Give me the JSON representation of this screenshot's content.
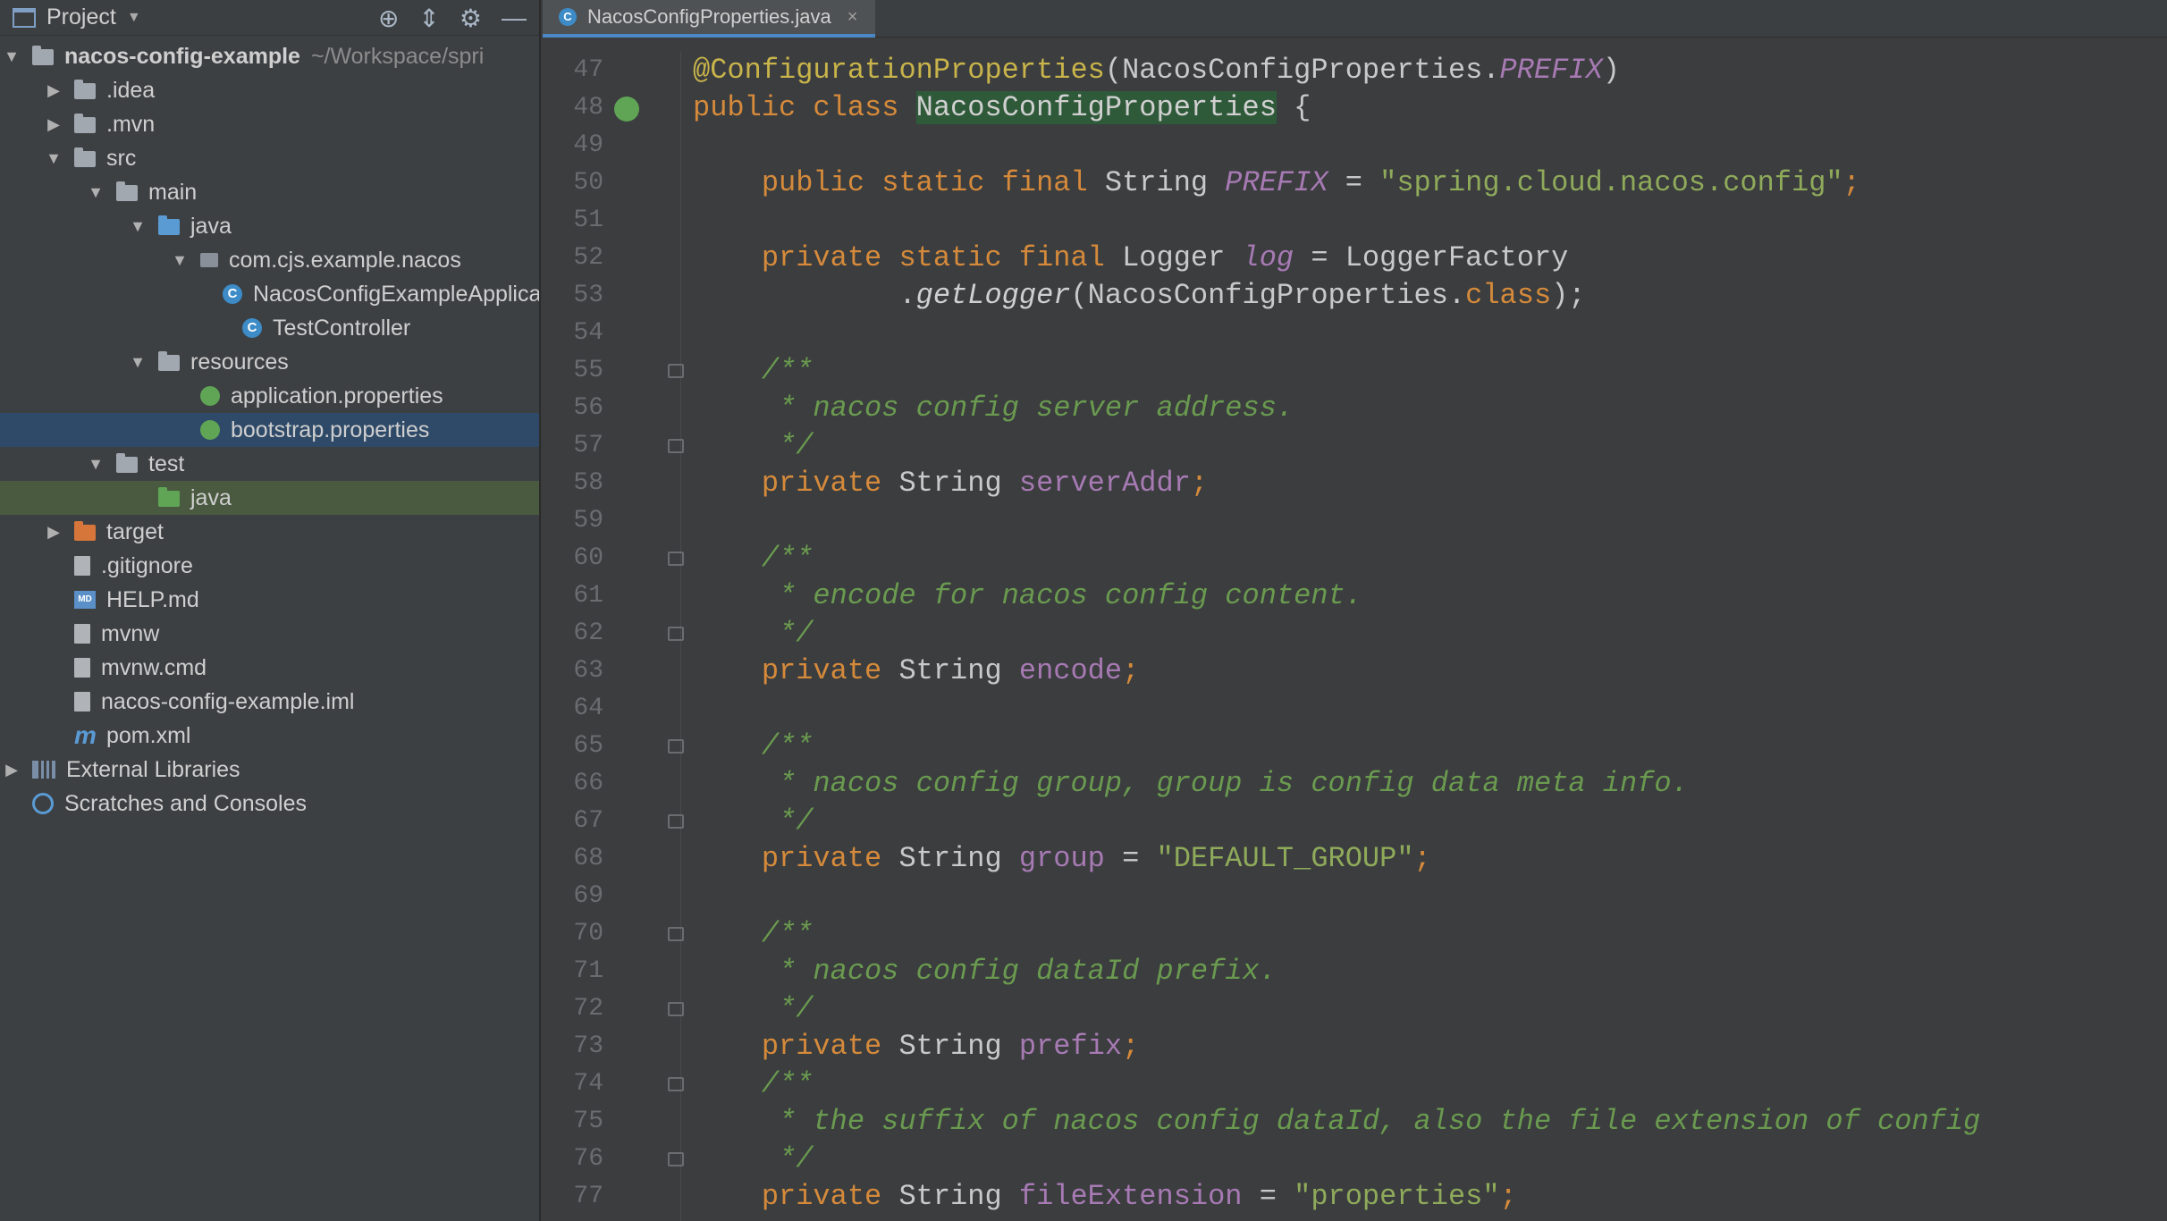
{
  "project": {
    "title": "Project",
    "tree": [
      {
        "label": "nacos-config-example",
        "suffix": "~/Workspace/spri",
        "depth": 0,
        "arrow": "▼",
        "icon": "module-folder",
        "bold": true
      },
      {
        "label": ".idea",
        "depth": 1,
        "arrow": "▶",
        "icon": "folder"
      },
      {
        "label": ".mvn",
        "depth": 1,
        "arrow": "▶",
        "icon": "folder"
      },
      {
        "label": "src",
        "depth": 1,
        "arrow": "▼",
        "icon": "folder"
      },
      {
        "label": "main",
        "depth": 2,
        "arrow": "▼",
        "icon": "folder"
      },
      {
        "label": "java",
        "depth": 3,
        "arrow": "▼",
        "icon": "folder-blue"
      },
      {
        "label": "com.cjs.example.nacos",
        "depth": 4,
        "arrow": "▼",
        "icon": "package"
      },
      {
        "label": "NacosConfigExampleApplica",
        "depth": 5,
        "arrow": "",
        "icon": "class"
      },
      {
        "label": "TestController",
        "depth": 5,
        "arrow": "",
        "icon": "class"
      },
      {
        "label": "resources",
        "depth": 3,
        "arrow": "▼",
        "icon": "folder-res"
      },
      {
        "label": "application.properties",
        "depth": 4,
        "arrow": "",
        "icon": "spring"
      },
      {
        "label": "bootstrap.properties",
        "depth": 4,
        "arrow": "",
        "icon": "spring",
        "selected": true
      },
      {
        "label": "test",
        "depth": 2,
        "arrow": "▼",
        "icon": "folder"
      },
      {
        "label": "java",
        "depth": 3,
        "arrow": "",
        "icon": "folder-green",
        "highlight": true
      },
      {
        "label": "target",
        "depth": 1,
        "arrow": "▶",
        "icon": "folder-orange"
      },
      {
        "label": ".gitignore",
        "depth": 1,
        "arrow": "",
        "icon": "file"
      },
      {
        "label": "HELP.md",
        "depth": 1,
        "arrow": "",
        "icon": "md"
      },
      {
        "label": "mvnw",
        "depth": 1,
        "arrow": "",
        "icon": "file"
      },
      {
        "label": "mvnw.cmd",
        "depth": 1,
        "arrow": "",
        "icon": "file"
      },
      {
        "label": "nacos-config-example.iml",
        "depth": 1,
        "arrow": "",
        "icon": "file"
      },
      {
        "label": "pom.xml",
        "depth": 1,
        "arrow": "",
        "icon": "maven"
      },
      {
        "label": "External Libraries",
        "depth": 0,
        "arrow": "▶",
        "icon": "libs"
      },
      {
        "label": "Scratches and Consoles",
        "depth": 0,
        "arrow": "",
        "icon": "scratch"
      }
    ]
  },
  "editor": {
    "tab": {
      "label": "NacosConfigProperties.java",
      "icon_letter": "C"
    },
    "lines": [
      {
        "n": "47",
        "tokens": [
          [
            "ann",
            "@ConfigurationProperties"
          ],
          [
            "",
            "(NacosConfigProperties."
          ],
          [
            "fldi",
            "PREFIX"
          ],
          [
            "",
            ")"
          ]
        ]
      },
      {
        "n": "48",
        "run": true,
        "tokens": [
          [
            "kw",
            "public class "
          ],
          [
            "hl",
            "NacosConfigProperties"
          ],
          [
            "",
            " {"
          ]
        ]
      },
      {
        "n": "49",
        "tokens": []
      },
      {
        "n": "50",
        "tokens": [
          [
            "",
            "    "
          ],
          [
            "kw",
            "public static final "
          ],
          [
            "",
            "String "
          ],
          [
            "fldi",
            "PREFIX"
          ],
          [
            "",
            " = "
          ],
          [
            "str",
            "\"spring.cloud.nacos.config\""
          ],
          [
            "kw",
            ";"
          ]
        ]
      },
      {
        "n": "51",
        "tokens": []
      },
      {
        "n": "52",
        "tokens": [
          [
            "",
            "    "
          ],
          [
            "kw",
            "private static final "
          ],
          [
            "",
            "Logger "
          ],
          [
            "fldi",
            "log"
          ],
          [
            "",
            " = LoggerFactory"
          ]
        ]
      },
      {
        "n": "53",
        "tokens": [
          [
            "",
            "            ."
          ],
          [
            "mth",
            "getLogger"
          ],
          [
            "",
            "(NacosConfigProperties."
          ],
          [
            "kw",
            "class"
          ],
          [
            "",
            ");"
          ]
        ]
      },
      {
        "n": "54",
        "tokens": []
      },
      {
        "n": "55",
        "fold": true,
        "tokens": [
          [
            "",
            "    "
          ],
          [
            "cm",
            "/**"
          ]
        ]
      },
      {
        "n": "56",
        "tokens": [
          [
            "",
            "    "
          ],
          [
            "cm",
            " * nacos config server address."
          ]
        ]
      },
      {
        "n": "57",
        "fold": true,
        "tokens": [
          [
            "",
            "    "
          ],
          [
            "cm",
            " */"
          ]
        ]
      },
      {
        "n": "58",
        "tokens": [
          [
            "",
            "    "
          ],
          [
            "kw",
            "private "
          ],
          [
            "",
            "String "
          ],
          [
            "fld",
            "serverAddr"
          ],
          [
            "kw",
            ";"
          ]
        ]
      },
      {
        "n": "59",
        "tokens": []
      },
      {
        "n": "60",
        "fold": true,
        "tokens": [
          [
            "",
            "    "
          ],
          [
            "cm",
            "/**"
          ]
        ]
      },
      {
        "n": "61",
        "tokens": [
          [
            "",
            "    "
          ],
          [
            "cm",
            " * encode for nacos config content."
          ]
        ]
      },
      {
        "n": "62",
        "fold": true,
        "tokens": [
          [
            "",
            "    "
          ],
          [
            "cm",
            " */"
          ]
        ]
      },
      {
        "n": "63",
        "tokens": [
          [
            "",
            "    "
          ],
          [
            "kw",
            "private "
          ],
          [
            "",
            "String "
          ],
          [
            "fld",
            "encode"
          ],
          [
            "kw",
            ";"
          ]
        ]
      },
      {
        "n": "64",
        "tokens": []
      },
      {
        "n": "65",
        "fold": true,
        "tokens": [
          [
            "",
            "    "
          ],
          [
            "cm",
            "/**"
          ]
        ]
      },
      {
        "n": "66",
        "tokens": [
          [
            "",
            "    "
          ],
          [
            "cm",
            " * nacos config group, group is config data meta info."
          ]
        ]
      },
      {
        "n": "67",
        "fold": true,
        "tokens": [
          [
            "",
            "    "
          ],
          [
            "cm",
            " */"
          ]
        ]
      },
      {
        "n": "68",
        "tokens": [
          [
            "",
            "    "
          ],
          [
            "kw",
            "private "
          ],
          [
            "",
            "String "
          ],
          [
            "fld",
            "group"
          ],
          [
            "",
            " = "
          ],
          [
            "str",
            "\"DEFAULT_GROUP\""
          ],
          [
            "kw",
            ";"
          ]
        ]
      },
      {
        "n": "69",
        "tokens": []
      },
      {
        "n": "70",
        "fold": true,
        "tokens": [
          [
            "",
            "    "
          ],
          [
            "cm",
            "/**"
          ]
        ]
      },
      {
        "n": "71",
        "tokens": [
          [
            "",
            "    "
          ],
          [
            "cm",
            " * nacos config dataId prefix."
          ]
        ]
      },
      {
        "n": "72",
        "fold": true,
        "tokens": [
          [
            "",
            "    "
          ],
          [
            "cm",
            " */"
          ]
        ]
      },
      {
        "n": "73",
        "tokens": [
          [
            "",
            "    "
          ],
          [
            "kw",
            "private "
          ],
          [
            "",
            "String "
          ],
          [
            "fld",
            "prefix"
          ],
          [
            "kw",
            ";"
          ]
        ]
      },
      {
        "n": "74",
        "fold": true,
        "tokens": [
          [
            "",
            "    "
          ],
          [
            "cm",
            "/**"
          ]
        ]
      },
      {
        "n": "75",
        "tokens": [
          [
            "",
            "    "
          ],
          [
            "cm",
            " * the suffix of nacos config dataId, also the file extension of config"
          ]
        ]
      },
      {
        "n": "76",
        "fold": true,
        "tokens": [
          [
            "",
            "    "
          ],
          [
            "cm",
            " */"
          ]
        ]
      },
      {
        "n": "77",
        "tokens": [
          [
            "",
            "    "
          ],
          [
            "kw",
            "private "
          ],
          [
            "",
            "String "
          ],
          [
            "fld",
            "fileExtension"
          ],
          [
            "",
            " = "
          ],
          [
            "str",
            "\"properties\""
          ],
          [
            "kw",
            ";"
          ]
        ]
      }
    ]
  }
}
